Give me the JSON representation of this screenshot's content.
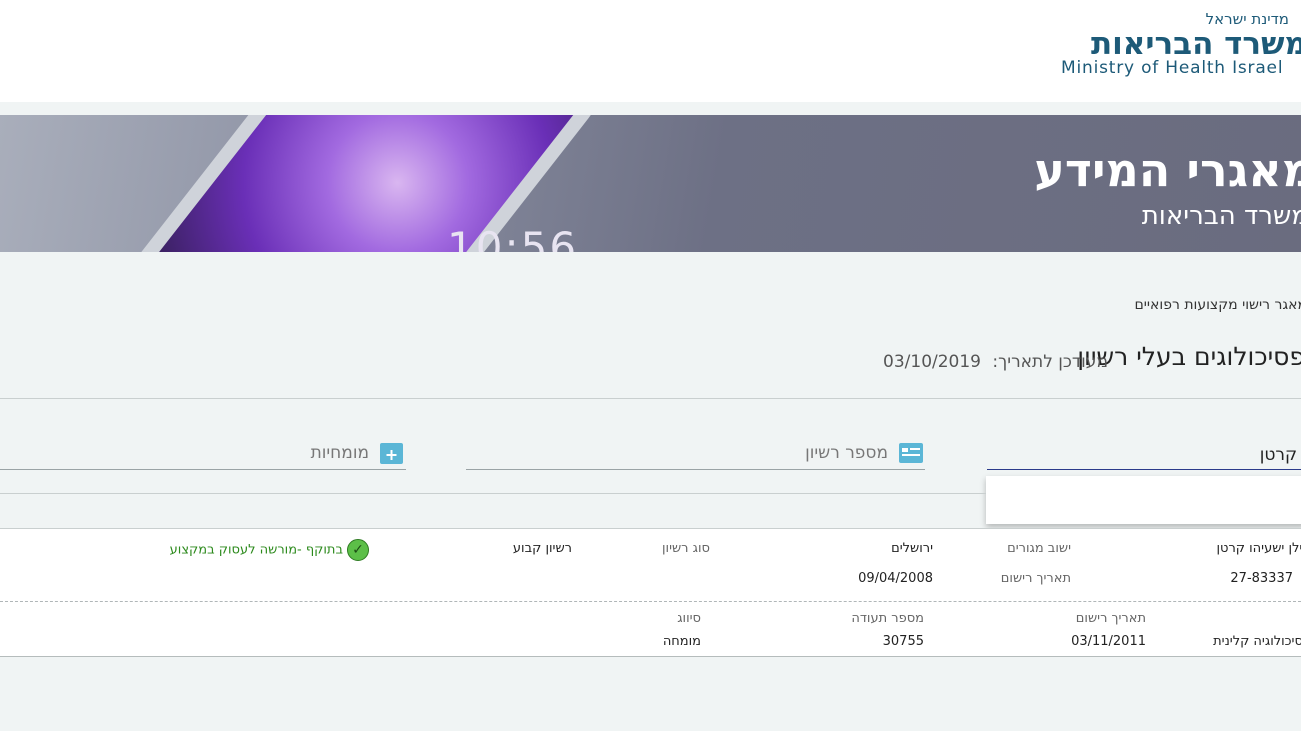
{
  "header": {
    "logo_top": "מדינת ישראל",
    "logo_main": "משרד הבריאות",
    "logo_en": "Ministry of Health Israel"
  },
  "banner": {
    "clock": "10:56",
    "title": "מאגרי המידע",
    "subtitle": "משרד הבריאות"
  },
  "breadcrumb": "מאגר רישוי מקצועות רפואיים",
  "page": {
    "title": "פסיכולוגים בעלי רשיון",
    "updated_label": "מעודכן לתאריך:",
    "updated_value": "03/10/2019"
  },
  "search": {
    "name_value": "קרטן",
    "license_placeholder": "מספר רשיון",
    "specialty_placeholder": "מומחיות"
  },
  "result": {
    "name": "אילן ישעיהו קרטן",
    "license_number": "27-83337",
    "city_label": "ישוב מגורים",
    "city": "ירושלים",
    "reg_date_label": "תאריך רישום",
    "reg_date": "09/04/2008",
    "license_type_label": "סוג רשיון",
    "license_type": "רשיון קבוע",
    "status": "בתוקף -מורשה לעסוק במקצוע",
    "status_color": "#2c8a1c",
    "specialty": {
      "name": "פסיכולוגיה קלינית",
      "reg_date_label": "תאריך רישום",
      "reg_date": "03/11/2011",
      "cert_label": "מספר תעודה",
      "cert": "30755",
      "class_label": "סיווג",
      "class": "מומחה"
    }
  },
  "colors": {
    "brand": "#1d5a78",
    "icon_accent": "#5bb6d6",
    "active_underline": "#2a3a8a"
  }
}
